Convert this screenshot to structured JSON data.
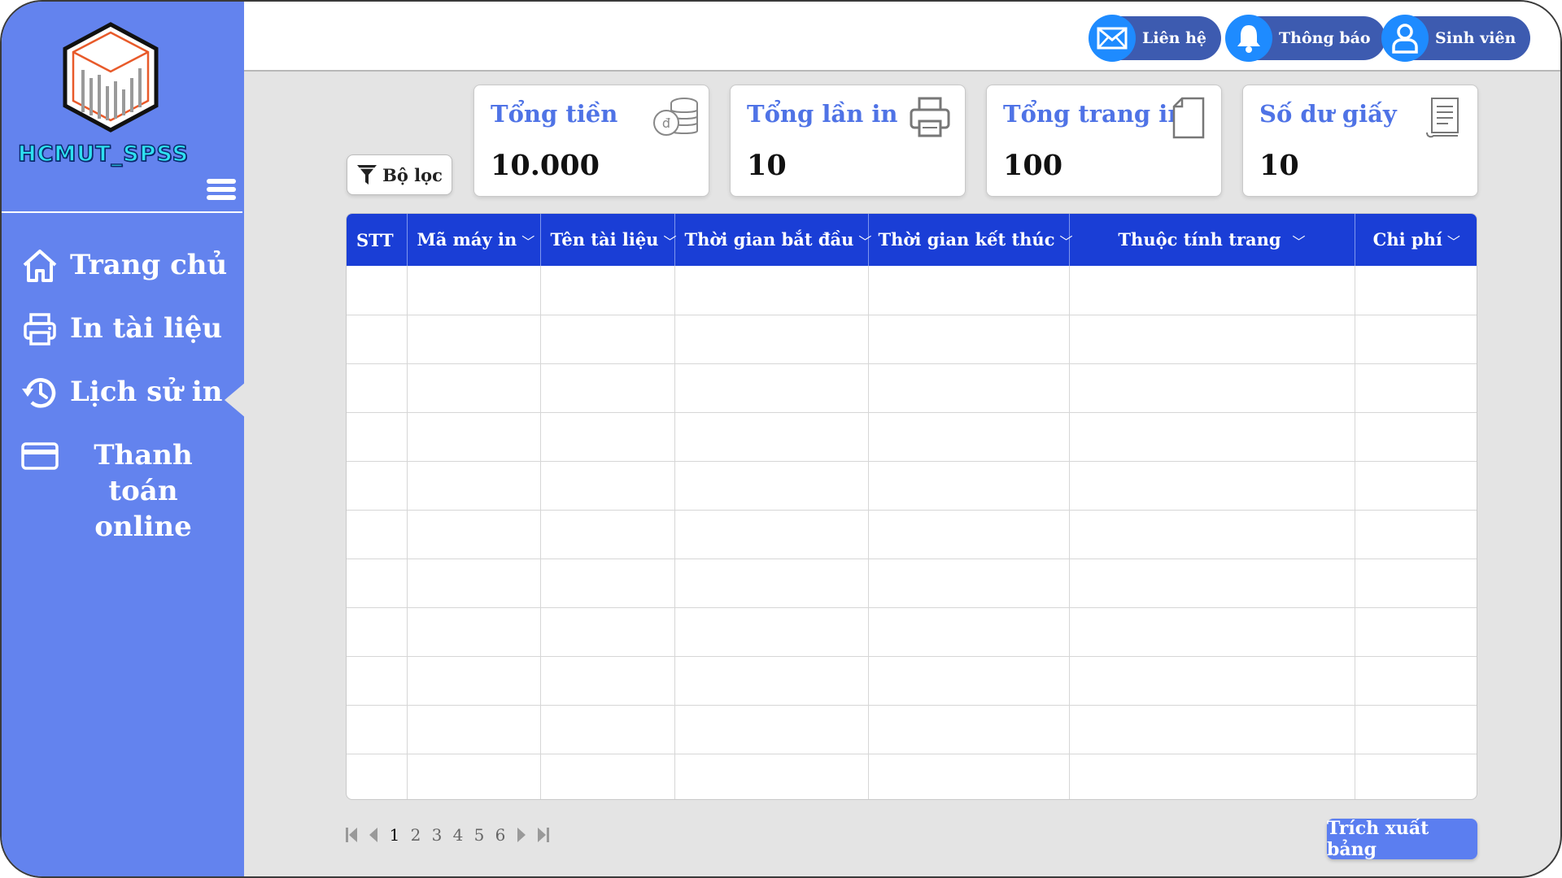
{
  "app": {
    "brand": "HCMUT_SPSS"
  },
  "sidebar": {
    "items": [
      {
        "label": "Trang chủ",
        "icon": "home-icon"
      },
      {
        "label": "In tài liệu",
        "icon": "printer-icon"
      },
      {
        "label": "Lịch sử in",
        "icon": "history-icon",
        "active": true
      },
      {
        "label_line1": "Thanh toán",
        "label_line2": "online",
        "icon": "credit-card-icon"
      }
    ]
  },
  "header": {
    "contact": "Liên hệ",
    "notifications": "Thông báo",
    "user": "Sinh viên"
  },
  "filter": {
    "label": "Bộ lọc"
  },
  "stats": [
    {
      "title": "Tổng tiền",
      "value": "10.000",
      "icon": "coins-icon"
    },
    {
      "title": "Tổng lần in",
      "value": "10",
      "icon": "printer-icon"
    },
    {
      "title": "Tổng trang in",
      "value": "100",
      "icon": "page-icon"
    },
    {
      "title": "Số dư giấy",
      "value": "10",
      "icon": "receipt-icon"
    }
  ],
  "table": {
    "columns": [
      "STT",
      "Mã máy in",
      "Tên tài liệu",
      "Thời gian bắt đầu",
      "Thời gian kết thúc",
      "Thuộc tính trang",
      "Chi phí"
    ],
    "rows": []
  },
  "pagination": {
    "pages": [
      "1",
      "2",
      "3",
      "4",
      "5",
      "6"
    ],
    "current": "1"
  },
  "export": {
    "label": "Trích xuất bảng"
  },
  "colors": {
    "sidebar": "#6383ee",
    "header_row": "#1a3ed6",
    "accent_text": "#4f73e6",
    "pill": "#3d5bb0",
    "pill_icon": "#1e8bff"
  }
}
